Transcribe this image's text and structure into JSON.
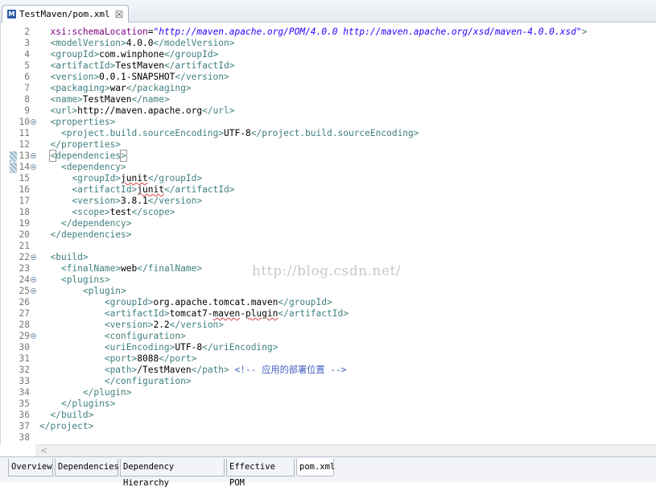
{
  "editor_tab": {
    "icon": "maven-m-icon",
    "title": "TestMaven/pom.xml",
    "close_glyph": "☒"
  },
  "lines": [
    {
      "n": "2",
      "html": "  <span class='attr'>xsi:schemaLocation</span>=<span class='str'>\"http://maven.apache.org/POM/4.0.0 http://maven.apache.org/xsd/maven-4.0.0.xsd\"</span><span class='tag'>&gt;</span>"
    },
    {
      "n": "3",
      "html": "  <span class='tag'>&lt;modelVersion&gt;</span>4.0.0<span class='tag'>&lt;/modelVersion&gt;</span>"
    },
    {
      "n": "4",
      "html": "  <span class='tag'>&lt;groupId&gt;</span>com.winphone<span class='tag'>&lt;/groupId&gt;</span>"
    },
    {
      "n": "5",
      "html": "  <span class='tag'>&lt;artifactId&gt;</span>TestMaven<span class='tag'>&lt;/artifactId&gt;</span>"
    },
    {
      "n": "6",
      "html": "  <span class='tag'>&lt;version&gt;</span>0.0.1-SNAPSHOT<span class='tag'>&lt;/version&gt;</span>"
    },
    {
      "n": "7",
      "html": "  <span class='tag'>&lt;packaging&gt;</span>war<span class='tag'>&lt;/packaging&gt;</span>"
    },
    {
      "n": "8",
      "html": "  <span class='tag'>&lt;name&gt;</span>TestMaven<span class='tag'>&lt;/name&gt;</span>"
    },
    {
      "n": "9",
      "html": "  <span class='tag'>&lt;url&gt;</span>http://maven.apache.org<span class='tag'>&lt;/url&gt;</span>"
    },
    {
      "n": "10",
      "fold": true,
      "html": "  <span class='tag'>&lt;properties&gt;</span>"
    },
    {
      "n": "11",
      "html": "    <span class='tag'>&lt;project.build.sourceEncoding&gt;</span>UTF-8<span class='tag'>&lt;/project.build.sourceEncoding&gt;</span>"
    },
    {
      "n": "12",
      "html": "  <span class='tag'>&lt;/properties&gt;</span>"
    },
    {
      "n": "13",
      "fold": true,
      "changed": true,
      "html": "  <span class='tag'><span class='hl'>&lt;</span>dependencies<span class='hl'>&gt;</span></span><span class='caret'></span>"
    },
    {
      "n": "14",
      "fold": true,
      "changed": true,
      "html": "    <span class='tag'>&lt;dependency&gt;</span>"
    },
    {
      "n": "15",
      "html": "      <span class='tag'>&lt;groupId&gt;</span><span class='err'>junit</span><span class='tag'>&lt;/groupId&gt;</span>"
    },
    {
      "n": "16",
      "html": "      <span class='tag'>&lt;artifactId&gt;</span><span class='err'>junit</span><span class='tag'>&lt;/artifactId&gt;</span>"
    },
    {
      "n": "17",
      "html": "      <span class='tag'>&lt;version&gt;</span>3.8.1<span class='tag'>&lt;/version&gt;</span>"
    },
    {
      "n": "18",
      "html": "      <span class='tag'>&lt;scope&gt;</span>test<span class='tag'>&lt;/scope&gt;</span>"
    },
    {
      "n": "19",
      "html": "    <span class='tag'>&lt;/dependency&gt;</span>"
    },
    {
      "n": "20",
      "html": "  <span class='tag'>&lt;/dependencies&gt;</span>"
    },
    {
      "n": "21",
      "html": ""
    },
    {
      "n": "22",
      "fold": true,
      "html": "  <span class='tag'>&lt;build&gt;</span>"
    },
    {
      "n": "23",
      "html": "    <span class='tag'>&lt;finalName&gt;</span>web<span class='tag'>&lt;/finalName&gt;</span>"
    },
    {
      "n": "24",
      "fold": true,
      "html": "    <span class='tag'>&lt;plugins&gt;</span>"
    },
    {
      "n": "25",
      "fold": true,
      "html": "        <span class='tag'>&lt;plugin&gt;</span>"
    },
    {
      "n": "26",
      "html": "            <span class='tag'>&lt;groupId&gt;</span>org.apache.tomcat.maven<span class='tag'>&lt;/groupId&gt;</span>"
    },
    {
      "n": "27",
      "html": "            <span class='tag'>&lt;artifactId&gt;</span>tomcat7-<span class='err'>maven</span>-<span class='err'>plugin</span><span class='tag'>&lt;/artifactId&gt;</span>"
    },
    {
      "n": "28",
      "html": "            <span class='tag'>&lt;version&gt;</span>2.2<span class='tag'>&lt;/version&gt;</span>"
    },
    {
      "n": "29",
      "fold": true,
      "html": "            <span class='tag'>&lt;configuration&gt;</span>"
    },
    {
      "n": "30",
      "html": "            <span class='tag'>&lt;uriEncoding&gt;</span>UTF-8<span class='tag'>&lt;/uriEncoding&gt;</span>"
    },
    {
      "n": "31",
      "html": "            <span class='tag'>&lt;port&gt;</span>8088<span class='tag'>&lt;/port&gt;</span>"
    },
    {
      "n": "32",
      "html": "            <span class='tag'>&lt;path&gt;</span>/TestMaven<span class='tag'>&lt;/path&gt;</span> <span class='cmt'>&lt;!-- 应用的部署位置 --&gt;</span>"
    },
    {
      "n": "33",
      "html": "            <span class='tag'>&lt;/configuration&gt;</span>"
    },
    {
      "n": "34",
      "html": "        <span class='tag'>&lt;/plugin&gt;</span>"
    },
    {
      "n": "35",
      "html": "    <span class='tag'>&lt;/plugins&gt;</span>"
    },
    {
      "n": "36",
      "html": "  <span class='tag'>&lt;/build&gt;</span>"
    },
    {
      "n": "37",
      "html": "<span class='tag'>&lt;/project&gt;</span>"
    },
    {
      "n": "38",
      "html": ""
    }
  ],
  "watermark": "http://blog.csdn.net/",
  "scroll_arrow": "<",
  "bottom_tabs": [
    {
      "label": "Overview",
      "active": false
    },
    {
      "label": "Dependencies",
      "active": false
    },
    {
      "label": "Dependency Hierarchy",
      "active": false
    },
    {
      "label": "Effective POM",
      "active": false
    },
    {
      "label": "pom.xml",
      "active": true
    }
  ],
  "colors": {
    "tag": "#3f7f7f",
    "attribute": "#7f007f",
    "string": "#2a00ff",
    "comment": "#3f5fbf",
    "line_number": "#787878"
  }
}
